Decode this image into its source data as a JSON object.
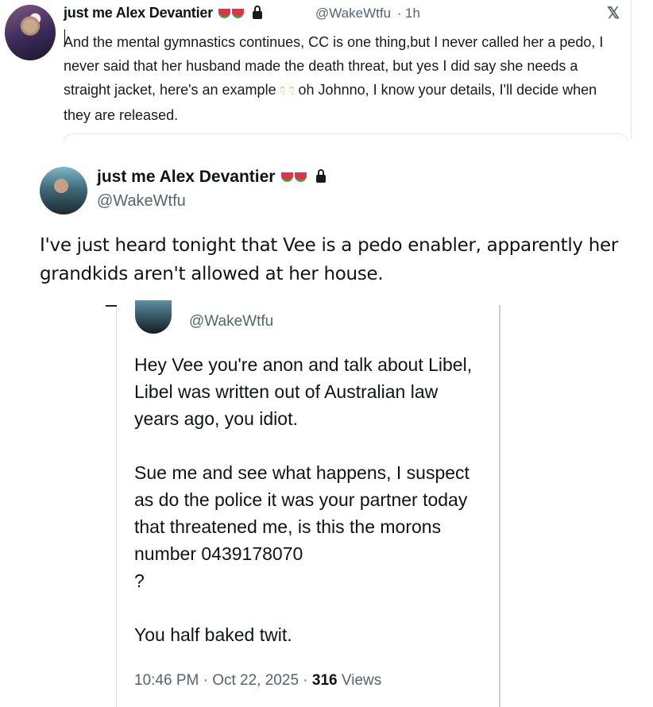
{
  "tweet1": {
    "author_name": "just me Alex Devantier",
    "handle": "@WakeWtfu",
    "separator": "·",
    "time": "1h",
    "text_before_emoji": "And the mental gymnastics continues, CC is one thing,but I never called her a pedo, I never said that her husband made the death threat, but yes I did say she needs a straight jacket, here's an example",
    "text_after_emoji": "oh Johnno, I know your details, I'll decide when they are released.",
    "badge_icons": [
      "watermelon-icon",
      "watermelon-icon",
      "lock-icon"
    ],
    "inline_icons": [
      "pointing-down-icon",
      "pointing-down-icon"
    ],
    "corner_icon": "x-logo-icon",
    "corner_glyph": "𝕏"
  },
  "tweet2": {
    "author_name": "just me Alex Devantier",
    "handle": "@WakeWtfu",
    "text": "I've just heard tonight that Vee is a pedo enabler, apparently her grandkids aren't allowed at her house.",
    "badge_icons": [
      "watermelon-icon",
      "watermelon-icon",
      "lock-icon"
    ]
  },
  "tweet3": {
    "handle": "@WakeWtfu",
    "text": "Hey Vee you're anon and talk about Libel, Libel was written out of Australian law years ago, you idiot.\n\nSue me and see what happens, I suspect as do the police it was your partner today that threatened me, is this the morons number 0439178070\n?\n\nYou half baked twit.",
    "timestamp": "10:46 PM · Oct 22, 2025",
    "separator": "·",
    "views_count": "316",
    "views_label": "Views"
  }
}
